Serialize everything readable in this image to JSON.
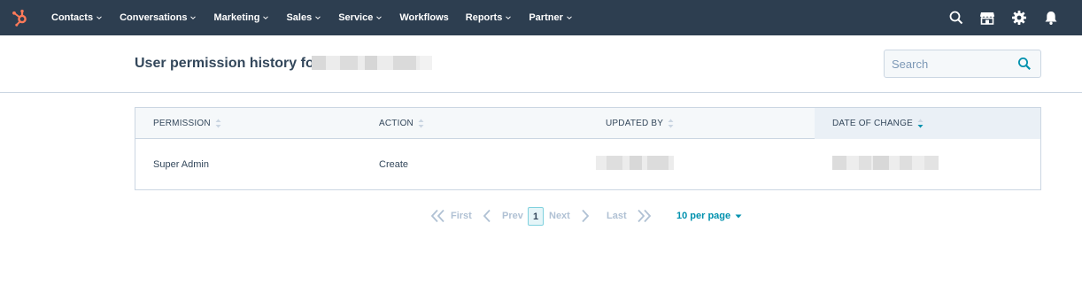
{
  "nav": {
    "items": [
      {
        "label": "Contacts",
        "dropdown": true
      },
      {
        "label": "Conversations",
        "dropdown": true
      },
      {
        "label": "Marketing",
        "dropdown": true
      },
      {
        "label": "Sales",
        "dropdown": true
      },
      {
        "label": "Service",
        "dropdown": true
      },
      {
        "label": "Workflows",
        "dropdown": false
      },
      {
        "label": "Reports",
        "dropdown": true
      },
      {
        "label": "Partner",
        "dropdown": true
      }
    ],
    "icons": [
      "search-icon",
      "marketplace-icon",
      "settings-icon",
      "notifications-icon"
    ]
  },
  "header": {
    "title": "User permission history for",
    "search_placeholder": "Search"
  },
  "table": {
    "columns": [
      {
        "label": "PERMISSION",
        "sorted": false
      },
      {
        "label": "ACTION",
        "sorted": false
      },
      {
        "label": "UPDATED BY",
        "sorted": false
      },
      {
        "label": "DATE OF CHANGE",
        "sorted": true
      }
    ],
    "rows": [
      {
        "permission": "Super Admin",
        "action": "Create",
        "updated_by": "",
        "date_of_change": ""
      }
    ]
  },
  "pagination": {
    "first_label": "First",
    "prev_label": "Prev",
    "current_page": "1",
    "next_label": "Next",
    "last_label": "Last",
    "per_page_label": "10 per page"
  },
  "colors": {
    "nav_bg": "#2d3e50",
    "accent": "#0091ae",
    "logo": "#ff7a59",
    "border": "#cbd6e2",
    "text": "#33475b"
  }
}
